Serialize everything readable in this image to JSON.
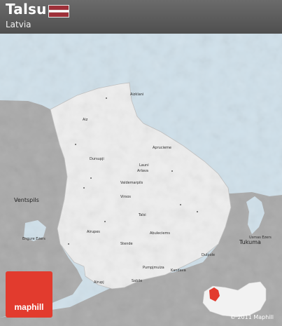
{
  "header": {
    "title": "Talsu",
    "country": "Latvia"
  },
  "flag": {
    "colors": [
      "#9e3039",
      "#ffffff",
      "#9e3039"
    ]
  },
  "colors": {
    "land": "#a9a9a9",
    "region": "#eeeeee",
    "sea": "#cfe0ea",
    "header": "#5a5a5a",
    "brand": "#e23b2e",
    "highlight": "#e23b2e"
  },
  "map": {
    "towns": [
      "Aizklani",
      "Aiz",
      "Dursupji",
      "Aprucieme",
      "Launi",
      "Arlava",
      "Valdemarpils",
      "Virsos",
      "Talsi",
      "Abuleciems",
      "Airupes",
      "Stende",
      "Dulpole",
      "Pumpjmuiza",
      "Kandava",
      "Sabile",
      "Airupj"
    ],
    "cities": [
      "Ventspils",
      "Tukuma"
    ],
    "waters": [
      "Engure Ezers",
      "Usmas Ezers"
    ]
  },
  "brand": {
    "name": "maphill"
  },
  "copyright": "© 2011 Maphill"
}
